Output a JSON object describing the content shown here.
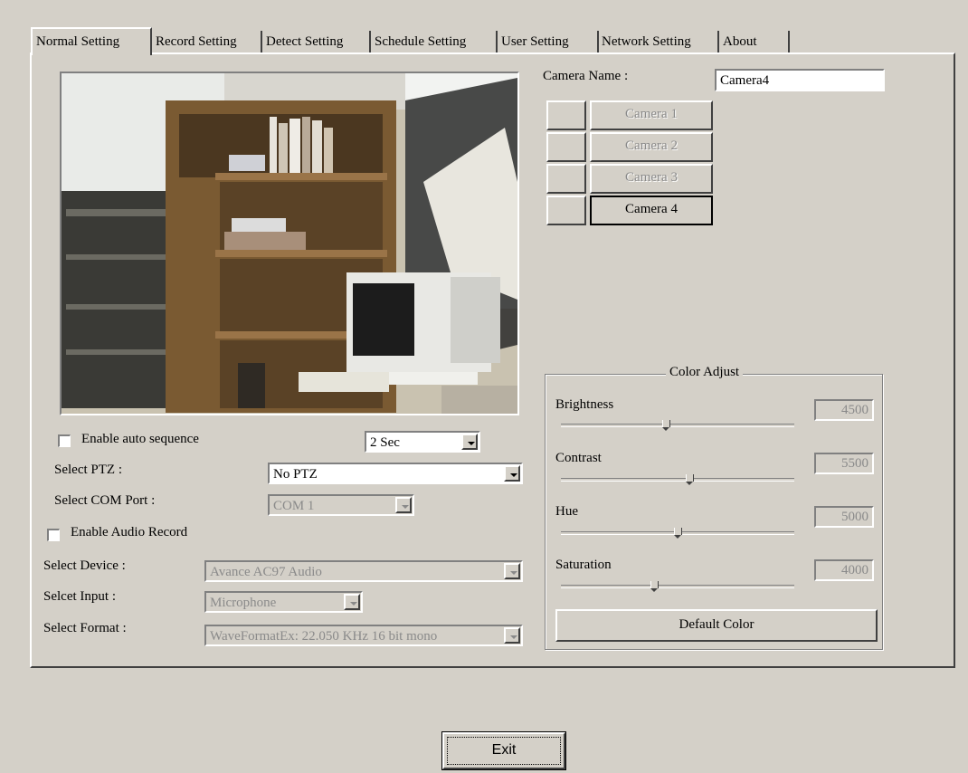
{
  "tabs": [
    {
      "label": "Normal Setting",
      "active": true
    },
    {
      "label": "Record Setting",
      "active": false
    },
    {
      "label": "Detect Setting",
      "active": false
    },
    {
      "label": "Schedule Setting",
      "active": false
    },
    {
      "label": "User Setting",
      "active": false
    },
    {
      "label": "Network Setting",
      "active": false
    },
    {
      "label": "About",
      "active": false
    }
  ],
  "camera_name": {
    "label": "Camera Name :",
    "value": "Camera4"
  },
  "cameras": [
    {
      "label": "Camera 1",
      "enabled": false
    },
    {
      "label": "Camera 2",
      "enabled": false
    },
    {
      "label": "Camera 3",
      "enabled": false
    },
    {
      "label": "Camera 4",
      "enabled": true
    }
  ],
  "auto_sequence": {
    "label": "Enable auto sequence",
    "checked": false,
    "interval": "2 Sec"
  },
  "ptz": {
    "label": "Select PTZ :",
    "value": "No PTZ"
  },
  "com_port": {
    "label": "Select COM Port :",
    "value": "COM 1",
    "enabled": false
  },
  "audio_record": {
    "label": "Enable Audio Record",
    "checked": false
  },
  "device": {
    "label": "Select Device :",
    "value": "Avance AC97 Audio",
    "enabled": false
  },
  "input": {
    "label": "Selcet Input :",
    "value": "Microphone",
    "enabled": false
  },
  "format": {
    "label": "Select Format :",
    "value": "WaveFormatEx: 22.050 KHz 16 bit mono",
    "enabled": false
  },
  "color_adjust": {
    "title": "Color Adjust",
    "sliders": [
      {
        "label": "Brightness",
        "value": "4500",
        "fraction": 0.45
      },
      {
        "label": "Contrast",
        "value": "5500",
        "fraction": 0.55
      },
      {
        "label": "Hue",
        "value": "5000",
        "fraction": 0.5
      },
      {
        "label": "Saturation",
        "value": "4000",
        "fraction": 0.4
      }
    ],
    "default_button": "Default Color"
  },
  "exit_button": "Exit"
}
